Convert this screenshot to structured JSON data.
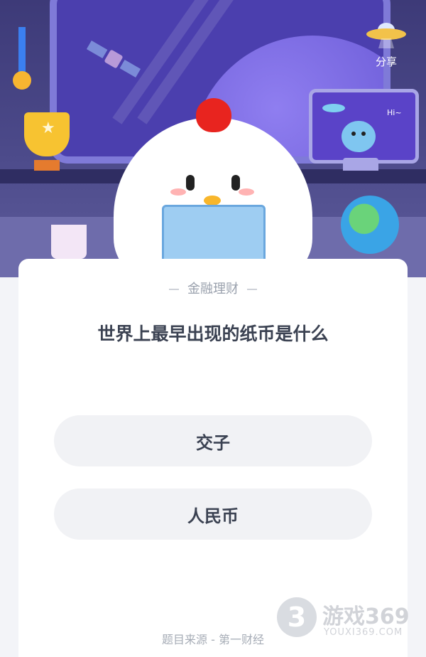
{
  "header": {
    "share_label": "分享",
    "monitor_greeting": "Hi~"
  },
  "quiz": {
    "category": "金融理财",
    "question": "世界上最早出现的纸币是什么",
    "options": [
      {
        "label": "交子"
      },
      {
        "label": "人民币"
      }
    ],
    "source": "题目来源 - 第一财经"
  },
  "watermark": {
    "badge": "3",
    "title": "游戏369",
    "subtitle": "YOUXI369.COM"
  },
  "icons": {
    "share": "ufo-icon",
    "satellite": "satellite-icon",
    "trophy": "trophy-icon",
    "medal": "medal-icon",
    "earth": "earth-globe-icon",
    "mascot": "chick-mascot",
    "alien": "alien-icon"
  },
  "colors": {
    "scene_bg": "#3d3a78",
    "card_bg": "#ffffff",
    "option_bg": "#f1f2f5",
    "question_text": "#3b4252",
    "muted_text": "#9aa1ad"
  }
}
